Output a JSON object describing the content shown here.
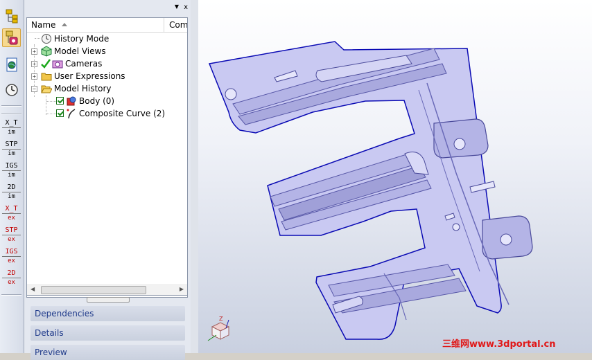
{
  "iconbar": {
    "tools": [
      {
        "icon": "assembly-tree-icon"
      },
      {
        "icon": "model-history-icon",
        "active": true
      },
      {
        "icon": "globe-page-icon"
      },
      {
        "icon": "clock-icon"
      }
    ],
    "formats": [
      {
        "top": "X_T",
        "bottom": "im",
        "color": "#000000"
      },
      {
        "top": "STP",
        "bottom": "im",
        "color": "#000000"
      },
      {
        "top": "IGS",
        "bottom": "im",
        "color": "#000000"
      },
      {
        "top": "2D",
        "bottom": "im",
        "color": "#000000"
      },
      {
        "top": "X_T",
        "bottom": "ex",
        "color": "#c00000"
      },
      {
        "top": "STP",
        "bottom": "ex",
        "color": "#c00000"
      },
      {
        "top": "IGS",
        "bottom": "ex",
        "color": "#c00000"
      },
      {
        "top": "2D",
        "bottom": "ex",
        "color": "#c00000"
      }
    ]
  },
  "panel": {
    "close_label": "x",
    "columns": {
      "name": "Name",
      "comment": "Com"
    },
    "tree": [
      {
        "label": "History Mode",
        "icon": "clock-icon"
      },
      {
        "label": "Model Views",
        "icon": "views-icon"
      },
      {
        "label": "Cameras",
        "icon": "camera-icon"
      },
      {
        "label": "User Expressions",
        "icon": "folder-icon"
      },
      {
        "label": "Model History",
        "icon": "folder-open-icon"
      },
      {
        "label": "Body (0)",
        "icon": "body-icon"
      },
      {
        "label": "Composite Curve (2)",
        "icon": "curve-icon"
      }
    ],
    "sections": [
      "Dependencies",
      "Details",
      "Preview"
    ]
  },
  "viewport": {
    "part_color": "#c9c9f2",
    "edge_color": "#0a0ab4",
    "watermark": "三维网www.3dportal.cn"
  }
}
